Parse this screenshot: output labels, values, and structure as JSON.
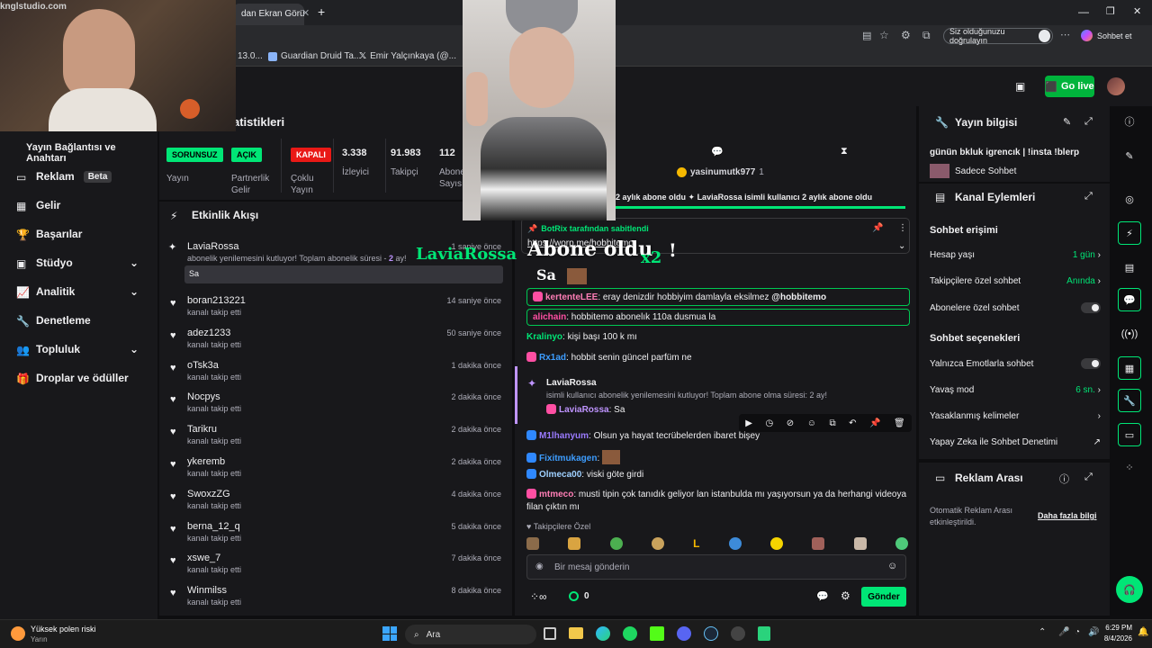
{
  "browser": {
    "tabs": [
      "dan Ekran Görün"
    ],
    "addressbar": {
      "privacy_text": "Siz olduğunuzu doğrulayın",
      "chat_label": "Sohbet et"
    },
    "bookmarks": [
      "13.0...",
      "Guardian Druid Ta...",
      "Emir Yalçınkaya (@..."
    ]
  },
  "webcam": {
    "watermark": "knglstudio.com"
  },
  "topnav": {
    "go_live": "Go live"
  },
  "sidebar": {
    "section_title": "Yayın Bağlantısı ve Anahtarı",
    "items": [
      {
        "label": "Reklam",
        "badge": "Beta"
      },
      {
        "label": "Gelir"
      },
      {
        "label": "Başarılar"
      },
      {
        "label": "Stüdyo"
      },
      {
        "label": "Analitik"
      },
      {
        "label": "Denetleme"
      },
      {
        "label": "Topluluk"
      },
      {
        "label": "Droplar ve ödüller"
      }
    ]
  },
  "stats": {
    "title": "atistikleri",
    "pills": [
      {
        "text": "SORUNSUZ",
        "label1": "Yayın",
        "label2": "",
        "color": "#00e676"
      },
      {
        "text": "AÇIK",
        "label1": "Partnerlik",
        "label2": "Gelir",
        "color": "#00e676"
      },
      {
        "text": "KAPALI",
        "label1": "Çoklu",
        "label2": "Yayın",
        "color": "#e91916"
      }
    ],
    "numbers": [
      {
        "value": "3.338",
        "label1": "İzleyici",
        "label2": ""
      },
      {
        "value": "91.983",
        "label1": "Takipçi",
        "label2": ""
      },
      {
        "value": "112",
        "label1": "Abone",
        "label2": "Sayısı"
      }
    ]
  },
  "activity": {
    "title": "Etkinlik Akışı",
    "top_item": {
      "name": "LaviaRossa",
      "text": "abonelik yenilemesini kutluyor! Toplam abonelik süresi - ",
      "months": "2",
      "months_suffix": " ay!",
      "message": "Sa",
      "time": "1 saniye önce"
    },
    "items": [
      {
        "name": "boran213221",
        "sub": "kanalı takip etti",
        "time": "14 saniye önce"
      },
      {
        "name": "adez1233",
        "sub": "kanalı takip etti",
        "time": "50 saniye önce"
      },
      {
        "name": "oTsk3a",
        "sub": "kanalı takip etti",
        "time": "1 dakika önce"
      },
      {
        "name": "Nocpys",
        "sub": "kanalı takip etti",
        "time": "2 dakika önce"
      },
      {
        "name": "Tarikru",
        "sub": "kanalı takip etti",
        "time": "2 dakika önce"
      },
      {
        "name": "ykeremb",
        "sub": "kanalı takip etti",
        "time": "2 dakika önce"
      },
      {
        "name": "SwoxzZG",
        "sub": "kanalı takip etti",
        "time": "4 dakika önce"
      },
      {
        "name": "berna_12_q",
        "sub": "kanalı takip etti",
        "time": "5 dakika önce"
      },
      {
        "name": "xswe_7",
        "sub": "kanalı takip etti",
        "time": "7 dakika önce"
      },
      {
        "name": "Winmilss",
        "sub": "kanalı takip etti",
        "time": "8 dakika önce"
      }
    ]
  },
  "overlay": {
    "name": "LaviaRossa",
    "headline": "Abone oldu",
    "multiplier": "x2",
    "excl": "!",
    "sa": "Sa"
  },
  "chat": {
    "top_gifter": "yasinumutk977",
    "top_gifter_count": "1",
    "ticker": "2 aylık abone oldu ✦ LaviaRossa isimli kullanıcı 2 aylık abone oldu",
    "pinned": {
      "by": "BotRix tarafından sabitlendi",
      "link": "https://worp.me/hobbitemo"
    },
    "messages": [
      {
        "user": "kertenteLEE",
        "text": ": eray denizdir hobbiyim damlayla eksilmez ",
        "mention": "@hobbitemo",
        "color": "#ff7eb6",
        "boxed": true
      },
      {
        "user": "alichain",
        "text": ": hobbitemo abonelık 110a dusmua la",
        "mention": "",
        "color": "#ff4fa3",
        "boxed": true
      },
      {
        "user": "Kralinyo",
        "text": ": kişi başı 100 k mı",
        "mention": "",
        "color": "#00e676",
        "boxed": false
      },
      {
        "user": "Rx1ad",
        "text": ": hobbit senin güncel parfüm ne",
        "mention": "",
        "color": "#3d9dff",
        "boxed": false
      }
    ],
    "resub": {
      "user": "LaviaRossa",
      "text": "isimli kullanıcı abonelik yenilemesini kutluyor! Toplam abone olma süresi: 2 ay!",
      "reply_user": "LaviaRossa",
      "reply_text": ": Sa"
    },
    "messages2": [
      {
        "user": "M1lhanyum",
        "text": ": Olsun ya hayat tecrübelerden ibaret bişey",
        "color": "#9b7bff"
      },
      {
        "user": "Fixitmukagen",
        "text": ":",
        "color": "#3d9dff"
      },
      {
        "user": "Olmeca00",
        "text": ": viski göte girdi",
        "color": "#9fd0ff"
      },
      {
        "user": "mtmeco",
        "text": ": musti tipin çok tanıdık geliyor lan istanbulda mı yaşıyorsun ya da herhangi videoya",
        "color": "#ff7eb6"
      }
    ],
    "wrap_line": "filan çıktın mı",
    "follower_only": "Takipçilere Özel",
    "input_placeholder": "Bir mesaj gönderin",
    "points": "0",
    "send": "Gönder"
  },
  "info_panel": {
    "title": "Yayın bilgisi",
    "stream_title": "günün bkluk igrencık | !insta !blerp",
    "category": "Sadece Sohbet"
  },
  "actions_panel": {
    "title": "Kanal Eylemleri",
    "access_title": "Sohbet erişimi",
    "rows": [
      {
        "label": "Hesap yaşı",
        "value": "1 gün"
      },
      {
        "label": "Takipçilere özel sohbet",
        "value": "Anında"
      },
      {
        "label": "Abonelere özel sohbet",
        "value": ""
      }
    ],
    "options_title": "Sohbet seçenekleri",
    "rows2": [
      {
        "label": "Yalnızca Emotlarla sohbet",
        "value": ""
      },
      {
        "label": "Yavaş mod",
        "value": "6 sn."
      },
      {
        "label": "Yasaklanmış kelimeler",
        "value": ""
      },
      {
        "label": "Yapay Zeka ile Sohbet Denetimi",
        "value": ""
      }
    ]
  },
  "ads_panel": {
    "title": "Reklam Arası",
    "text": "Otomatik Reklam Arası etkinleştirildi.",
    "link": "Daha fazla bilgi"
  },
  "taskbar": {
    "weather_title": "Yüksek polen riski",
    "weather_sub": "Yarın",
    "search": "Ara",
    "time": "6:29 PM",
    "date": "8/4/2026"
  },
  "colors": {
    "accent": "#00e676",
    "purple": "#9146ff",
    "bg": "#18181b"
  }
}
